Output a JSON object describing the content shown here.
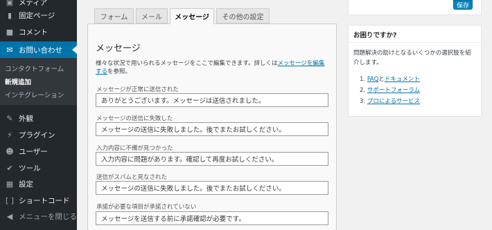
{
  "sidebar": {
    "items": [
      {
        "label": "メディア",
        "icon": "media-icon"
      },
      {
        "label": "固定ページ",
        "icon": "page-icon"
      },
      {
        "label": "コメント",
        "icon": "comment-icon"
      },
      {
        "label": "お問い合わせ",
        "icon": "mail-icon",
        "active": true
      },
      {
        "label": "外観",
        "icon": "brush-icon"
      },
      {
        "label": "プラグイン",
        "icon": "plugin-icon"
      },
      {
        "label": "ユーザー",
        "icon": "user-icon"
      },
      {
        "label": "ツール",
        "icon": "wrench-icon"
      },
      {
        "label": "設定",
        "icon": "settings-icon"
      },
      {
        "label": "ショートコード",
        "icon": "shortcode-icon"
      },
      {
        "label": "メニューを閉じる",
        "icon": "collapse-icon"
      }
    ],
    "submenu": [
      "コンタクトフォーム",
      "新規追加",
      "インテグレーション"
    ]
  },
  "tabs": [
    "フォーム",
    "メール",
    "メッセージ",
    "その他の設定"
  ],
  "panel": {
    "title": "メッセージ",
    "desc_before": "様々な状況で用いられるメッセージをここで編集できます。詳しくは",
    "desc_link": "メッセージを編集する",
    "desc_after": "を参照。",
    "messages": [
      {
        "label": "メッセージが正常に送信された",
        "value": "ありがとうございます。メッセージは送信されました。"
      },
      {
        "label": "メッセージの送信に失敗した",
        "value": "メッセージの送信に失敗しました。後でまたお試しください。"
      },
      {
        "label": "入力内容に不備が見つかった",
        "value": "入力内容に問題があります。確認して再度お試しください。"
      },
      {
        "label": "送信がスパムと見なされた",
        "value": "メッセージの送信に失敗しました。後でまたお試しください。"
      },
      {
        "label": "承諾が必要な項目が承諾されていない",
        "value": "メッセージを送信する前に承諾確認が必要です。"
      }
    ]
  },
  "publish": {
    "save_label": "保存"
  },
  "help": {
    "title": "お困りですか?",
    "text": "問題解決の助けとなるいくつかの選択肢を紹介します。",
    "links": [
      {
        "num": "1.",
        "a": "FAQ",
        "mid": "と",
        "b": "ドキュメント"
      },
      {
        "num": "2.",
        "a": "サポートフォーラム"
      },
      {
        "num": "3.",
        "a": "プロによるサービス"
      }
    ]
  },
  "colors": {
    "sidebar": "#23282d",
    "accent": "#0073aa",
    "button": "#0085ba"
  }
}
